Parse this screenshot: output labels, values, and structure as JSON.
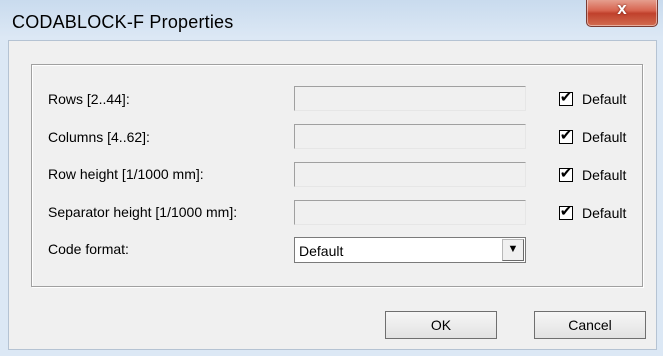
{
  "window": {
    "title": "CODABLOCK-F Properties",
    "close_glyph": "x"
  },
  "rows": [
    {
      "label": "Rows [2..44]:",
      "value": "",
      "checkbox_label": "Default",
      "checked": true
    },
    {
      "label": "Columns [4..62]:",
      "value": "",
      "checkbox_label": "Default",
      "checked": true
    },
    {
      "label": "Row height [1/1000 mm]:",
      "value": "",
      "checkbox_label": "Default",
      "checked": true
    },
    {
      "label": "Separator height [1/1000 mm]:",
      "value": "",
      "checkbox_label": "Default",
      "checked": true
    }
  ],
  "code_format": {
    "label": "Code format:",
    "selected": "Default"
  },
  "buttons": {
    "ok": "OK",
    "cancel": "Cancel"
  },
  "glyphs": {
    "check": "✔",
    "dropdown": "▼"
  },
  "colors": {
    "dialog_bg": "#f0f0f0",
    "close_button": "#c0412c",
    "frame": "#dce8f5"
  }
}
